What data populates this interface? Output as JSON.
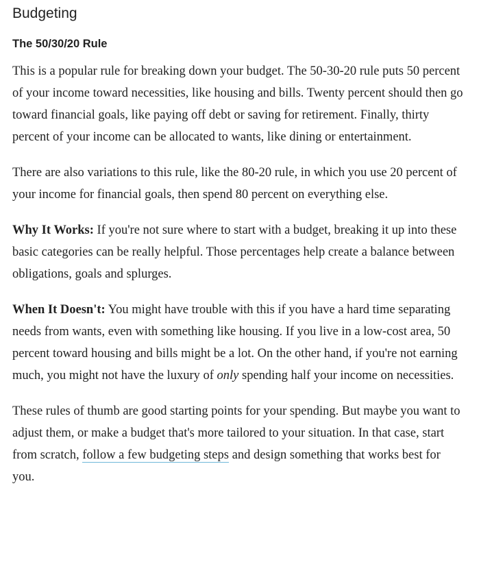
{
  "section": {
    "heading": "Budgeting",
    "subheading": "The 50/30/20 Rule"
  },
  "paragraphs": {
    "intro": "This is a popular rule for breaking down your budget. The 50-30-20 rule puts 50 percent of your income toward necessities, like housing and bills. Twenty percent should then go toward financial goals, like paying off debt or saving for retirement. Finally, thirty percent of your income can be allocated to wants, like dining or entertainment.",
    "variations": "There are also variations to this rule, like the 80-20 rule, in which you use 20 percent of your income for financial goals, then spend 80 percent on everything else.",
    "why_label": "Why It Works:",
    "why_text": " If you're not sure where to start with a budget, breaking it up into these basic categories can be really helpful. Those percentages help create a balance between obligations, goals and splurges.",
    "when_label": "When It Doesn't:",
    "when_text_1": " You might have trouble with this if you have a hard time separating needs from wants, even with something like housing. If you live in a low-cost area, 50 percent toward housing and bills might be a lot. On the other hand, if you're not earning much, you might not have the luxury of ",
    "when_emphasis": "only",
    "when_text_2": " spending half your income on necessities.",
    "closing_text_1": "These rules of thumb are good starting points for your spending. But maybe you want to adjust them, or make a budget that's more tailored to your situation. In that case, start from scratch, ",
    "closing_link": "follow a few budgeting steps",
    "closing_text_2": " and design something that works best for you."
  },
  "colors": {
    "text": "#222222",
    "link_underline": "#6fb7d9",
    "background": "#ffffff"
  }
}
